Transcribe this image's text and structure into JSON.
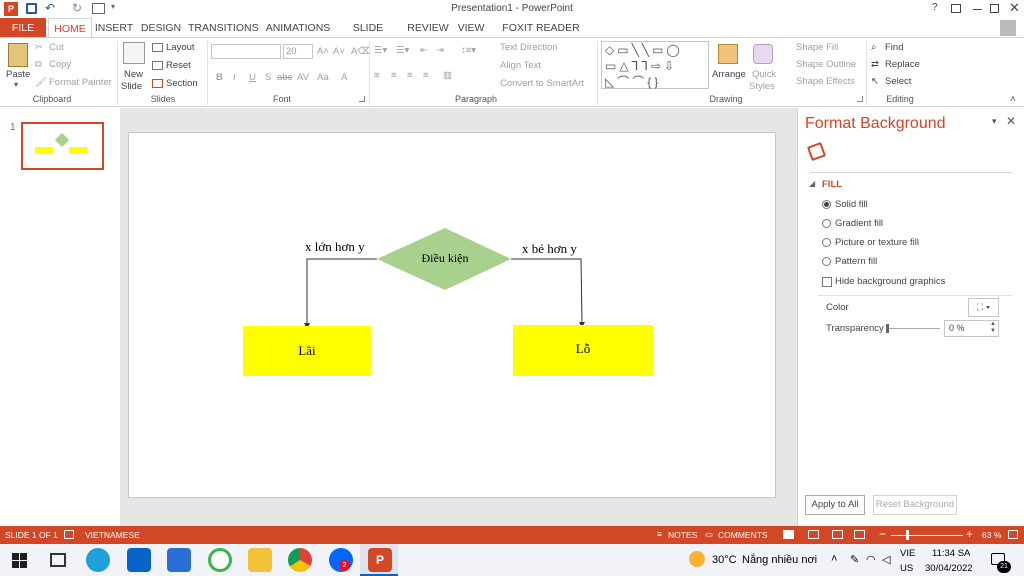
{
  "window": {
    "title": "Presentation1 - PowerPoint",
    "help": "?"
  },
  "tabs": [
    "FILE",
    "HOME",
    "INSERT",
    "DESIGN",
    "TRANSITIONS",
    "ANIMATIONS",
    "SLIDE SHOW",
    "REVIEW",
    "VIEW",
    "FOXIT READER PDF"
  ],
  "ribbon": {
    "clipboard": {
      "paste": "Paste",
      "cut": "Cut",
      "copy": "Copy",
      "format_painter": "Format Painter",
      "label": "Clipboard"
    },
    "slides": {
      "new_slide": "New",
      "new_slide2": "Slide",
      "layout": "Layout",
      "reset": "Reset",
      "section": "Section",
      "label": "Slides"
    },
    "font": {
      "size": "20",
      "label": "Font",
      "bold": "B",
      "italic": "I",
      "underline": "U",
      "strike": "S",
      "abc": "abc",
      "av": "AV",
      "aa": "Aa"
    },
    "paragraph": {
      "text_direction": "Text Direction",
      "align_text": "Align Text",
      "smartart": "Convert to SmartArt",
      "label": "Paragraph"
    },
    "drawing": {
      "arrange": "Arrange",
      "quick": "Quick",
      "styles": "Styles",
      "shape_fill": "Shape Fill",
      "shape_outline": "Shape Outline",
      "shape_effects": "Shape Effects",
      "label": "Drawing"
    },
    "editing": {
      "find": "Find",
      "replace": "Replace",
      "select": "Select",
      "label": "Editing"
    }
  },
  "thumbnail": {
    "number": "1"
  },
  "slide": {
    "condition": "Điều kiện",
    "left_label": "x lớn hơn y",
    "right_label": "x bé hơn y",
    "left_box": "Lãi",
    "right_box": "Lỗ"
  },
  "pane": {
    "title": "Format Background",
    "section": "FILL",
    "options": [
      "Solid fill",
      "Gradient fill",
      "Picture or texture fill",
      "Pattern fill"
    ],
    "hide_bg": "Hide background graphics",
    "color_label": "Color",
    "transparency_label": "Transparency",
    "transparency_value": "0 %",
    "apply_all": "Apply to All",
    "reset_bg": "Reset Background"
  },
  "status": {
    "slide": "SLIDE 1 OF 1",
    "language": "VIETNAMESE",
    "notes": "NOTES",
    "comments": "COMMENTS",
    "zoom": "63 %"
  },
  "taskbar": {
    "temp": "30°C",
    "weather": "Nắng nhiều nơi",
    "lang1": "VIE",
    "lang2": "US",
    "time": "11:34 SA",
    "date": "30/04/2022",
    "badge": "2",
    "notif": "21"
  },
  "colors": {
    "accent": "#d24726",
    "diamond": "#a9d18e",
    "box": "#ffff00"
  }
}
